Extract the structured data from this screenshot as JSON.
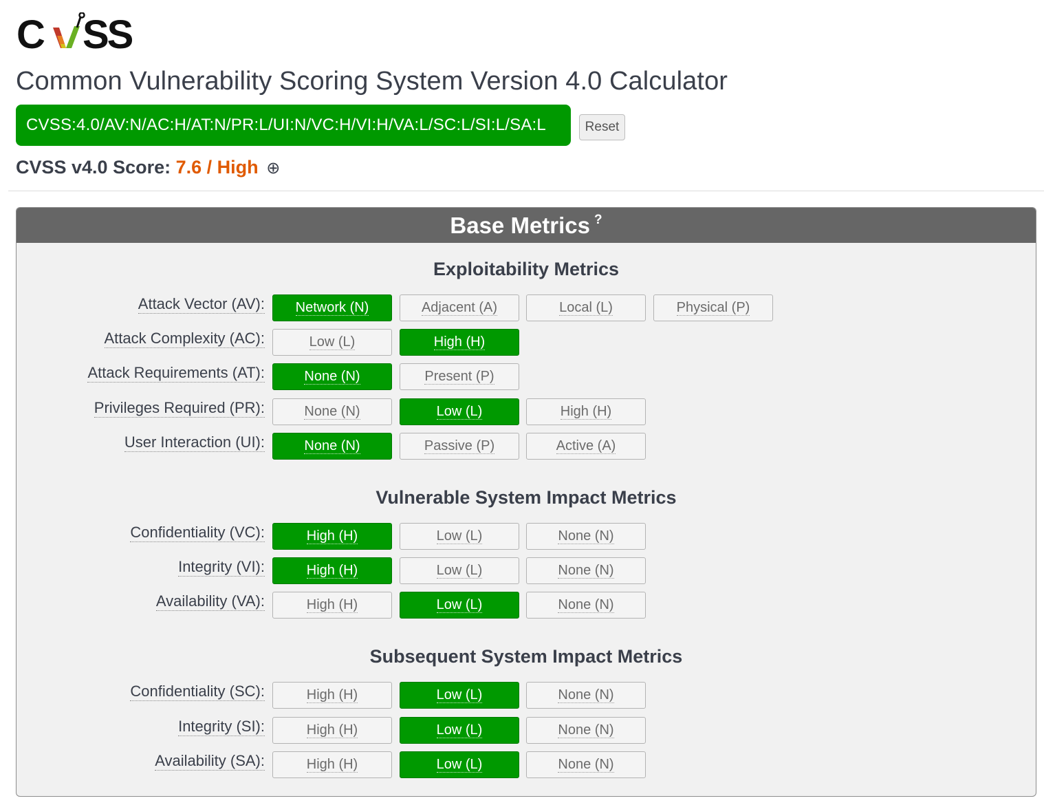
{
  "header": {
    "logo_text": "CVSS",
    "title": "Common Vulnerability Scoring System Version 4.0 Calculator",
    "vector": "CVSS:4.0/AV:N/AC:H/AT:N/PR:L/UI:N/VC:H/VI:H/VA:L/SC:L/SI:L/SA:L",
    "reset_label": "Reset",
    "score_label": "CVSS v4.0 Score:",
    "score_value": "7.6 / High",
    "expand_symbol": "⊕"
  },
  "colors": {
    "selected": "#009900",
    "header_bg": "#666666",
    "score": "#e05a00"
  },
  "panel": {
    "title": "Base Metrics",
    "help_symbol": "?",
    "groups": [
      {
        "title": "Exploitability Metrics",
        "metrics": [
          {
            "label": "Attack Vector (AV):",
            "options": [
              "Network (N)",
              "Adjacent (A)",
              "Local (L)",
              "Physical (P)"
            ],
            "selected": 0
          },
          {
            "label": "Attack Complexity (AC):",
            "options": [
              "Low (L)",
              "High (H)"
            ],
            "selected": 1
          },
          {
            "label": "Attack Requirements (AT):",
            "options": [
              "None (N)",
              "Present (P)"
            ],
            "selected": 0
          },
          {
            "label": "Privileges Required (PR):",
            "options": [
              "None (N)",
              "Low (L)",
              "High (H)"
            ],
            "selected": 1
          },
          {
            "label": "User Interaction (UI):",
            "options": [
              "None (N)",
              "Passive (P)",
              "Active (A)"
            ],
            "selected": 0
          }
        ]
      },
      {
        "title": "Vulnerable System Impact Metrics",
        "metrics": [
          {
            "label": "Confidentiality (VC):",
            "options": [
              "High (H)",
              "Low (L)",
              "None (N)"
            ],
            "selected": 0
          },
          {
            "label": "Integrity (VI):",
            "options": [
              "High (H)",
              "Low (L)",
              "None (N)"
            ],
            "selected": 0
          },
          {
            "label": "Availability (VA):",
            "options": [
              "High (H)",
              "Low (L)",
              "None (N)"
            ],
            "selected": 1
          }
        ]
      },
      {
        "title": "Subsequent System Impact Metrics",
        "metrics": [
          {
            "label": "Confidentiality (SC):",
            "options": [
              "High (H)",
              "Low (L)",
              "None (N)"
            ],
            "selected": 1
          },
          {
            "label": "Integrity (SI):",
            "options": [
              "High (H)",
              "Low (L)",
              "None (N)"
            ],
            "selected": 1
          },
          {
            "label": "Availability (SA):",
            "options": [
              "High (H)",
              "Low (L)",
              "None (N)"
            ],
            "selected": 1
          }
        ]
      }
    ]
  }
}
